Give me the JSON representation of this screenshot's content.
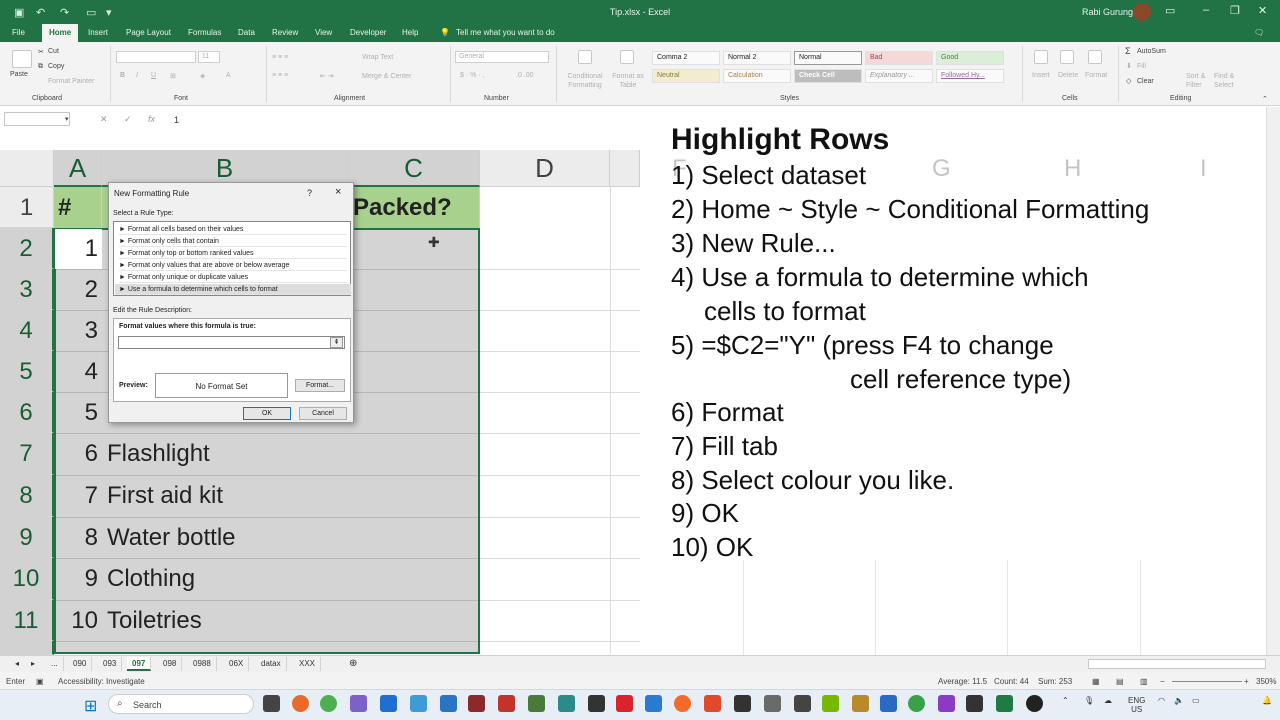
{
  "titlebar": {
    "title": "Tip.xlsx  -  Excel",
    "user": "Rabi Gurung",
    "undo_icon": "undo-icon",
    "redo_icon": "redo-icon"
  },
  "ribbon_tabs": [
    "File",
    "Home",
    "Insert",
    "Page Layout",
    "Formulas",
    "Data",
    "Review",
    "View",
    "Developer",
    "Help",
    "Tell me what you want to do"
  ],
  "ribbon": {
    "clipboard": {
      "paste": "Paste",
      "cut": "Cut",
      "copy": "Copy",
      "format_painter": "Format Painter",
      "label": "Clipboard"
    },
    "font": {
      "label": "Font",
      "size": "11",
      "bold": "B",
      "italic": "I",
      "underline": "U"
    },
    "alignment": {
      "wrap": "Wrap Text",
      "merge": "Merge & Center",
      "label": "Alignment"
    },
    "number": {
      "format": "General",
      "label": "Number"
    },
    "styles": {
      "conditional": "Conditional Formatting",
      "format_table": "Format as Table",
      "cells": [
        "Comma 2",
        "Normal 2",
        "Normal",
        "Bad",
        "Good",
        "Neutral",
        "Calculation",
        "Check Cell",
        "Explanatory ...",
        "Followed Hy..."
      ],
      "label": "Styles"
    },
    "cells": {
      "insert": "Insert",
      "delete": "Delete",
      "format": "Format",
      "label": "Cells"
    },
    "editing": {
      "autosum": "AutoSum",
      "fill": "Fill",
      "clear": "Clear",
      "sort": "Sort & Filter",
      "find": "Find & Select",
      "label": "Editing"
    }
  },
  "formula_bar": {
    "value": "1"
  },
  "sheet": {
    "columns": [
      "A",
      "B",
      "C",
      "D"
    ],
    "header_row": {
      "num": "#",
      "packed": "Packed?"
    },
    "rows": [
      {
        "row": "1",
        "num": "",
        "item": ""
      },
      {
        "row": "2",
        "num": "1",
        "item": ""
      },
      {
        "row": "3",
        "num": "2",
        "item": ""
      },
      {
        "row": "4",
        "num": "3",
        "item": ""
      },
      {
        "row": "5",
        "num": "4",
        "item": ""
      },
      {
        "row": "6",
        "num": "5",
        "item": ""
      },
      {
        "row": "7",
        "num": "6",
        "item": "Flashlight"
      },
      {
        "row": "8",
        "num": "7",
        "item": "First aid kit"
      },
      {
        "row": "9",
        "num": "8",
        "item": "Water bottle"
      },
      {
        "row": "10",
        "num": "9",
        "item": "Clothing"
      },
      {
        "row": "11",
        "num": "10",
        "item": "Toiletries"
      }
    ]
  },
  "dialog": {
    "title": "New Formatting Rule",
    "help": "?",
    "close": "×",
    "select_label": "Select a Rule Type:",
    "rules": [
      "► Format all cells based on their values",
      "► Format only cells that contain",
      "► Format only top or bottom ranked values",
      "► Format only values that are above or below average",
      "► Format only unique or duplicate values",
      "► Use a formula to determine which cells to format"
    ],
    "edit_label": "Edit the Rule Description:",
    "formula_label": "Format values where this formula is true:",
    "formula_value": "",
    "preview_label": "Preview:",
    "preview_text": "No Format Set",
    "format_button": "Format...",
    "ok": "OK",
    "cancel": "Cancel"
  },
  "instructions": {
    "ghost_columns": [
      "F",
      "G",
      "H",
      "I"
    ],
    "title": "Highlight Rows",
    "lines": [
      "1) Select dataset",
      "2) Home ~ Style ~ Conditional Formatting",
      "3) New Rule...",
      "4) Use a formula to determine which",
      "cells to format",
      "5) =$C2=\"Y\" (press F4 to change",
      "cell reference type)",
      "6) Format",
      "7) Fill tab",
      "8) Select colour you like.",
      "9) OK",
      "10) OK"
    ]
  },
  "sheet_tabs": [
    "...",
    "090",
    "093",
    "097",
    "098",
    "0988",
    "06X",
    "datax",
    "XXX"
  ],
  "active_sheet": "097",
  "status": {
    "mode": "Enter",
    "accessibility": "Accessibility: Investigate",
    "average": "Average: 11.5",
    "count": "Count: 44",
    "sum": "Sum: 253",
    "zoom": "350%"
  },
  "taskbar": {
    "search": "Search",
    "lang": "ENG",
    "region": "US"
  }
}
